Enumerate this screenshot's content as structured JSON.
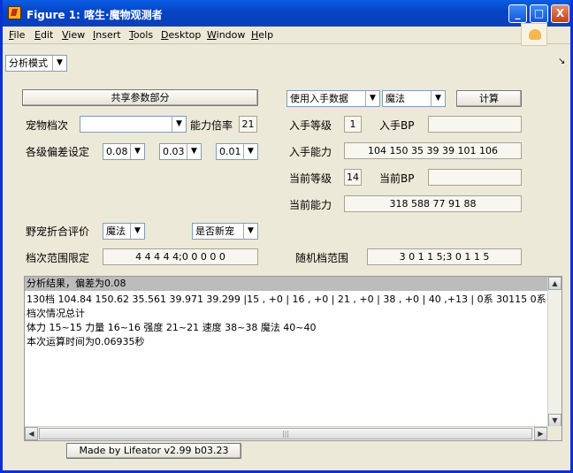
{
  "window": {
    "title": "Figure 1: 喀生·魔物观测者",
    "minimize": "_",
    "maximize": "□",
    "close": "X"
  },
  "menu": [
    {
      "label": "File",
      "key": "F",
      "rest": "ile"
    },
    {
      "label": "Edit",
      "key": "E",
      "rest": "dit"
    },
    {
      "label": "View",
      "key": "V",
      "rest": "iew"
    },
    {
      "label": "Insert",
      "key": "I",
      "rest": "nsert"
    },
    {
      "label": "Tools",
      "key": "T",
      "rest": "ools"
    },
    {
      "label": "Desktop",
      "key": "D",
      "rest": "esktop"
    },
    {
      "label": "Window",
      "key": "W",
      "rest": "indow"
    },
    {
      "label": "Help",
      "key": "H",
      "rest": "elp"
    }
  ],
  "dock_glyph": "↘",
  "mode_select": {
    "value": "分析模式"
  },
  "shared_button": "共享参数部分",
  "data_source_select": {
    "value": "使用入手数据"
  },
  "attr_select": {
    "value": "魔法"
  },
  "calc_button": "计算",
  "pet_tier": {
    "label": "宠物档次",
    "value": ""
  },
  "multiplier": {
    "label": "能力倍率",
    "value": "21"
  },
  "deviation": {
    "label": "各级偏差设定",
    "values": [
      "0.08",
      "0.03",
      "0.01"
    ]
  },
  "acquire_level": {
    "label": "入手等级",
    "value": "1"
  },
  "acquire_bp": {
    "label": "入手BP",
    "value": ""
  },
  "acquire_ability": {
    "label": "入手能力",
    "value": "104 150 35 39 39  101 106"
  },
  "current_level": {
    "label": "当前等级",
    "value": "14"
  },
  "current_bp": {
    "label": "当前BP",
    "value": ""
  },
  "current_ability": {
    "label": "当前能力",
    "value": "318 588 77 91 88"
  },
  "wild_eval": {
    "label": "野宠折合评价",
    "value": "魔法",
    "newpet": "是否新宠"
  },
  "tier_range": {
    "label": "档次范围限定",
    "value": "4 4 4 4 4;0 0 0 0 0"
  },
  "random_range": {
    "label": "随机档范围",
    "value": "3 0 1 1 5;3 0 1 1 5"
  },
  "output": {
    "header": "分析结果，偏差为0.08",
    "lines": [
      "130档 104.84 150.62 35.561 39.971 39.299 |15 , +0 | 16 , +0 | 21 , +0 | 38 , +0 | 40 ,+13 | 0系 30115  0系",
      "档次情况总计",
      "体力 15~15 力量 16~16 强度 21~21 速度 38~38 魔法 40~40",
      "本次运算时间为0.06935秒"
    ]
  },
  "footer_button": "Made by Lifeator   v2.99 b03.23"
}
